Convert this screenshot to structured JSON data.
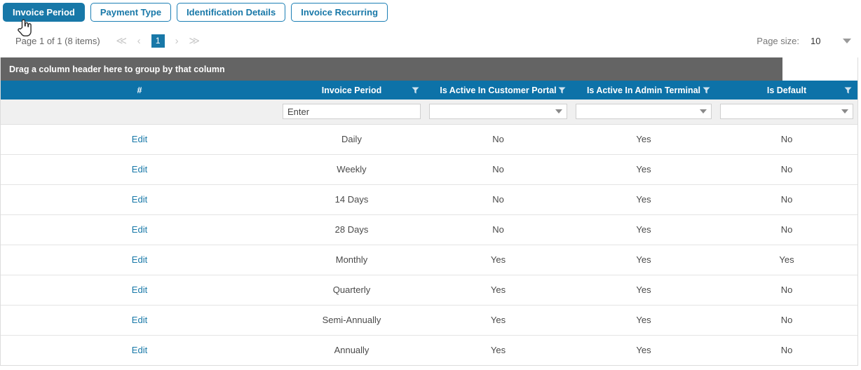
{
  "tabs": [
    {
      "label": "Invoice Period",
      "active": true
    },
    {
      "label": "Payment Type",
      "active": false
    },
    {
      "label": "Identification Details",
      "active": false
    },
    {
      "label": "Invoice Recurring",
      "active": false
    }
  ],
  "pager": {
    "info": "Page 1 of 1 (8 items)",
    "first_icon": "≪",
    "prev_icon": "‹",
    "current_page": "1",
    "next_icon": "›",
    "last_icon": "≫",
    "page_size_label": "Page size:",
    "page_size_value": "10"
  },
  "grid": {
    "group_hint": "Drag a column header here to group by that column",
    "columns": [
      {
        "label": "#",
        "filter_icon": false
      },
      {
        "label": "Invoice Period",
        "filter_icon": true
      },
      {
        "label": "Is Active In Customer Portal",
        "filter_icon": true
      },
      {
        "label": "Is Active In Admin Terminal",
        "filter_icon": true
      },
      {
        "label": "Is Default",
        "filter_icon": true
      }
    ],
    "filters": {
      "invoice_period_placeholder": "Enter",
      "invoice_period_value": "",
      "customer_portal_value": "",
      "admin_terminal_value": "",
      "is_default_value": ""
    },
    "edit_label": "Edit",
    "rows": [
      {
        "edit": "Edit",
        "period": "Daily",
        "customer_portal": "No",
        "admin_terminal": "Yes",
        "is_default": "No"
      },
      {
        "edit": "Edit",
        "period": "Weekly",
        "customer_portal": "No",
        "admin_terminal": "Yes",
        "is_default": "No"
      },
      {
        "edit": "Edit",
        "period": "14 Days",
        "customer_portal": "No",
        "admin_terminal": "Yes",
        "is_default": "No"
      },
      {
        "edit": "Edit",
        "period": "28 Days",
        "customer_portal": "No",
        "admin_terminal": "Yes",
        "is_default": "No"
      },
      {
        "edit": "Edit",
        "period": "Monthly",
        "customer_portal": "Yes",
        "admin_terminal": "Yes",
        "is_default": "Yes"
      },
      {
        "edit": "Edit",
        "period": "Quarterly",
        "customer_portal": "Yes",
        "admin_terminal": "Yes",
        "is_default": "No"
      },
      {
        "edit": "Edit",
        "period": "Semi-Annually",
        "customer_portal": "Yes",
        "admin_terminal": "Yes",
        "is_default": "No"
      },
      {
        "edit": "Edit",
        "period": "Annually",
        "customer_portal": "Yes",
        "admin_terminal": "Yes",
        "is_default": "No"
      }
    ]
  },
  "colors": {
    "accent_blue": "#1878a8",
    "header_blue": "#0d72a8",
    "group_gray": "#646464",
    "filter_row_gray": "#f0f0f0",
    "row_border": "#e4e4e4",
    "link_blue": "#1878a8"
  },
  "icons": {
    "filter_funnel": "filter-funnel-icon",
    "cursor": "hand-pointer-cursor",
    "chevron_down": "chevron-down-icon"
  }
}
